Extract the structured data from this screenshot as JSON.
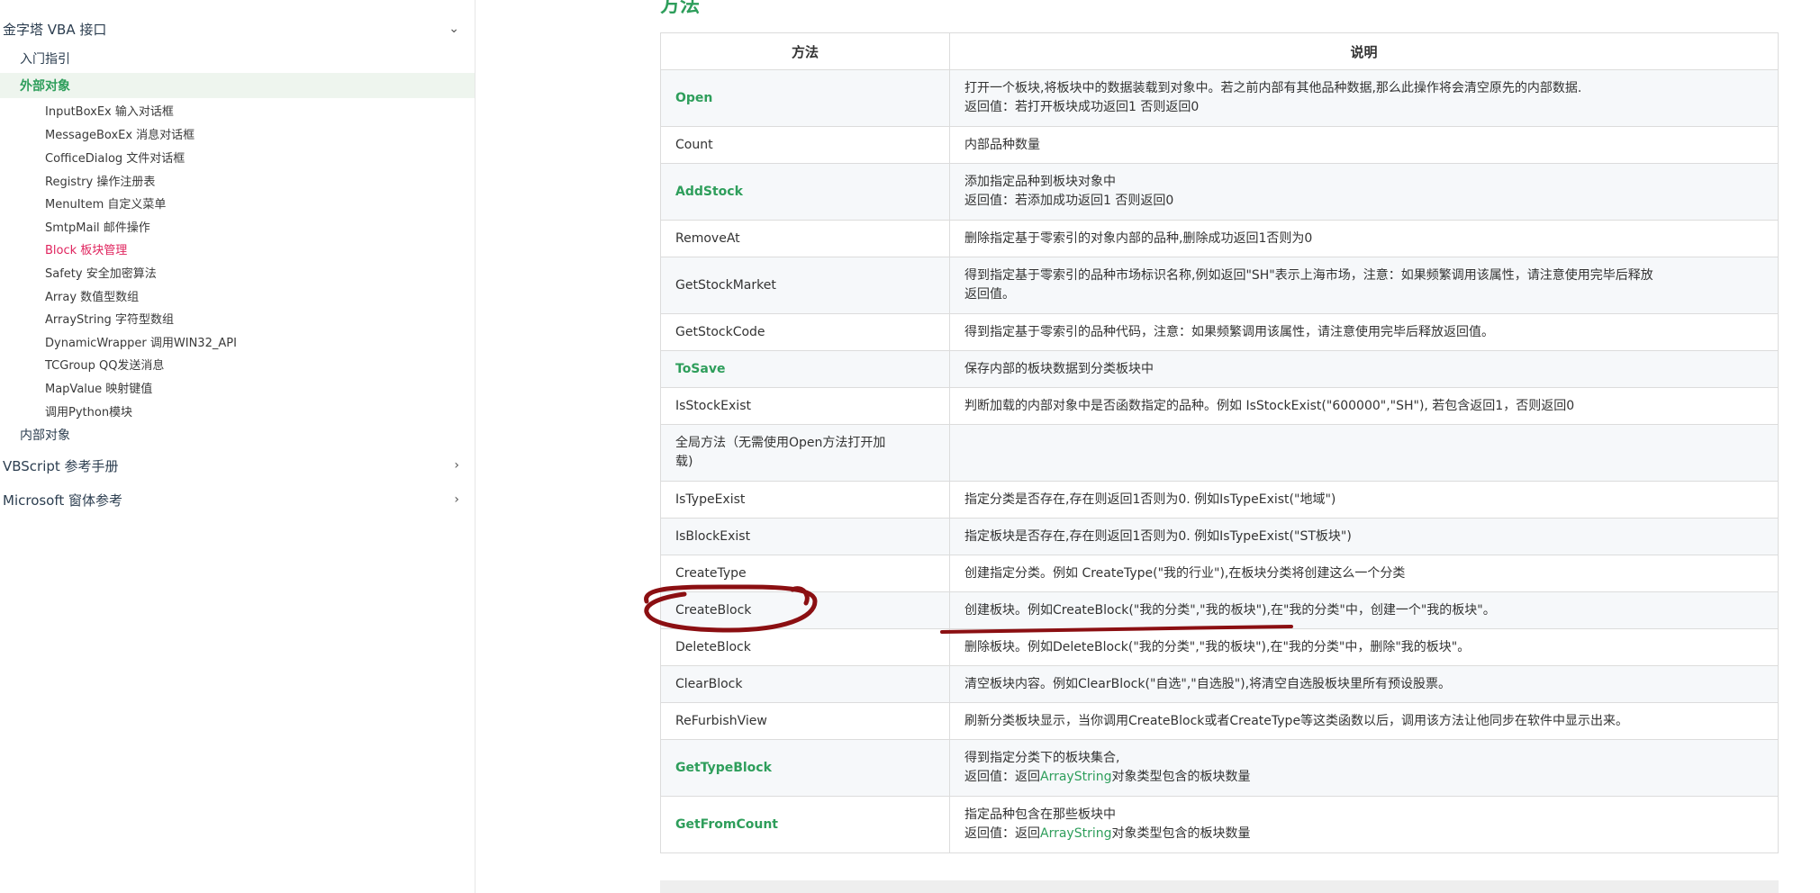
{
  "sidebar": {
    "section_vba": "金字塔 VBA 接口",
    "nav_intro": "入门指引",
    "nav_external": "外部对象",
    "sub_items": [
      "InputBoxEx 输入对话框",
      "MessageBoxEx 消息对话框",
      "CofficeDialog 文件对话框",
      "Registry 操作注册表",
      "MenuItem 自定义菜单",
      "SmtpMail 邮件操作",
      "Block 板块管理",
      "Safety 安全加密算法",
      "Array 数值型数组",
      "ArrayString 字符型数组",
      "DynamicWrapper 调用WIN32_API",
      "TCGroup QQ发送消息",
      "MapValue 映射键值",
      "调用Python模块"
    ],
    "nav_internal": "内部对象",
    "section_vbscript": "VBScript 参考手册",
    "section_forms": "Microsoft 窗体参考",
    "expand_down_icon": "chevron-down-icon",
    "expand_right_icon": "chevron-right-icon"
  },
  "main": {
    "heading": "方法",
    "col_method": "方法",
    "col_desc": "说明",
    "rows": [
      {
        "name": "Open",
        "desc1": "打开一个板块,将板块中的数据装载到对象中。若之前内部有其他品种数据,那么此操作将会清空原先的内部数据.",
        "desc2": "返回值：若打开板块成功返回1 否则返回0"
      },
      {
        "name": "Count",
        "desc1": "内部品种数量"
      },
      {
        "name": "AddStock",
        "desc1": "添加指定品种到板块对象中",
        "desc2": "返回值：若添加成功返回1 否则返回0"
      },
      {
        "name": "RemoveAt",
        "desc1": "删除指定基于零索引的对象内部的品种,删除成功返回1否则为0"
      },
      {
        "name": "GetStockMarket",
        "desc1": "得到指定基于零索引的品种市场标识名称,例如返回\"SH\"表示上海市场，注意：如果频繁调用该属性，请注意使用完毕后释放",
        "desc2": "返回值。"
      },
      {
        "name": "GetStockCode",
        "desc1": "得到指定基于零索引的品种代码，注意：如果频繁调用该属性，请注意使用完毕后释放返回值。"
      },
      {
        "name": "ToSave",
        "desc1": "保存内部的板块数据到分类板块中"
      },
      {
        "name": "IsStockExist",
        "desc1": "判断加载的内部对象中是否函数指定的品种。例如 IsStockExist(\"600000\",\"SH\"), 若包含返回1，否则返回0"
      },
      {
        "name1": "全局方法（无需使用Open方法打开加",
        "name2": "载)"
      },
      {
        "name": "IsTypeExist",
        "desc1": "指定分类是否存在,存在则返回1否则为0. 例如IsTypeExist(\"地域\")"
      },
      {
        "name": "IsBlockExist",
        "desc1": "指定板块是否存在,存在则返回1否则为0. 例如IsTypeExist(\"ST板块\")"
      },
      {
        "name": "CreateType",
        "desc1": "创建指定分类。例如 CreateType(\"我的行业\"),在板块分类将创建这么一个分类"
      },
      {
        "name": "CreateBlock",
        "desc1": "创建板块。例如CreateBlock(\"我的分类\",\"我的板块\"),在\"我的分类\"中，创建一个\"我的板块\"。"
      },
      {
        "name": "DeleteBlock",
        "desc1": "删除板块。例如DeleteBlock(\"我的分类\",\"我的板块\"),在\"我的分类\"中，删除\"我的板块\"。"
      },
      {
        "name": "ClearBlock",
        "desc1": "清空板块内容。例如ClearBlock(\"自选\",\"自选股\"),将清空自选股板块里所有预设股票。"
      },
      {
        "name": "ReFurbishView",
        "desc1": "刷新分类板块显示，当你调用CreateBlock或者CreateType等这类函数以后，调用该方法让他同步在软件中显示出来。"
      },
      {
        "name": "GetTypeBlock",
        "desc1": "得到指定分类下的板块集合,",
        "desc2a": "返回值：返回",
        "desc2link": "ArrayString",
        "desc2b": "对象类型包含的板块数量"
      },
      {
        "name": "GetFromCount",
        "desc1": "指定品种包含在那些板块中",
        "desc2a": "返回值：返回",
        "desc2link": "ArrayString",
        "desc2b": "对象类型包含的板块数量"
      }
    ]
  },
  "colors": {
    "accent_green": "#2e9e5b",
    "highlight_pink": "#e0245e",
    "annotation_red": "#8b0f12"
  }
}
